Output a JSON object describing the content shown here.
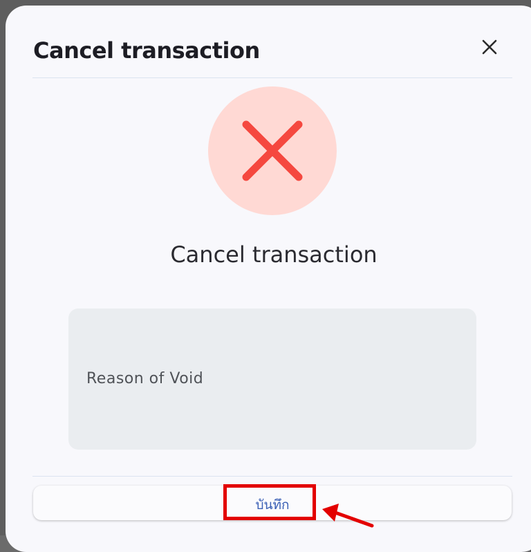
{
  "dialog": {
    "title": "Cancel transaction",
    "close_icon": "close-icon"
  },
  "status": {
    "icon": "x-mark-icon",
    "circle_color": "#ffd9d4",
    "icon_color": "#f5483f"
  },
  "message": "Cancel transaction",
  "reason_field": {
    "placeholder": "Reason of Void",
    "value": ""
  },
  "actions": {
    "save_label": "บันทึก"
  },
  "annotation": {
    "highlight_color": "#e30000",
    "arrow_icon": "arrow-pointer-icon"
  }
}
